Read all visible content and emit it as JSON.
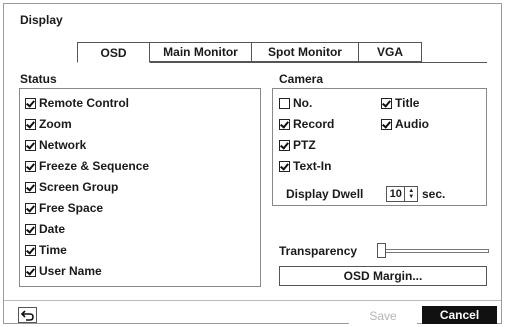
{
  "dialog": {
    "title": "Display"
  },
  "tabs": [
    {
      "label": "OSD",
      "active": true
    },
    {
      "label": "Main Monitor",
      "active": false
    },
    {
      "label": "Spot Monitor",
      "active": false
    },
    {
      "label": "VGA",
      "active": false
    }
  ],
  "status": {
    "heading": "Status",
    "items": [
      {
        "label": "Remote Control",
        "checked": true
      },
      {
        "label": "Zoom",
        "checked": true
      },
      {
        "label": "Network",
        "checked": true
      },
      {
        "label": "Freeze & Sequence",
        "checked": true
      },
      {
        "label": "Screen Group",
        "checked": true
      },
      {
        "label": "Free Space",
        "checked": true
      },
      {
        "label": "Date",
        "checked": true
      },
      {
        "label": "Time",
        "checked": true
      },
      {
        "label": "User Name",
        "checked": true
      }
    ]
  },
  "camera": {
    "heading": "Camera",
    "items": [
      {
        "label": "No.",
        "checked": false
      },
      {
        "label": "Title",
        "checked": true
      },
      {
        "label": "Record",
        "checked": true
      },
      {
        "label": "Audio",
        "checked": true
      },
      {
        "label": "PTZ",
        "checked": true
      },
      {
        "label": "Text-In",
        "checked": true
      }
    ],
    "display_dwell_label": "Display Dwell",
    "display_dwell_value": "10",
    "display_dwell_unit": "sec."
  },
  "transparency": {
    "label": "Transparency",
    "value": 0
  },
  "buttons": {
    "osd_margin": "OSD Margin...",
    "save": "Save",
    "cancel": "Cancel"
  },
  "icons": {
    "back": "back-arrow-icon"
  }
}
